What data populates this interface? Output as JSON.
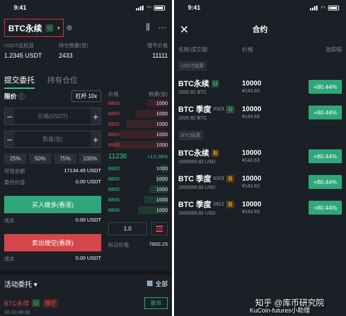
{
  "left": {
    "status_time": "9:41",
    "symbol": "BTC永续",
    "symbol_tag": "U",
    "stats": [
      {
        "label": "USDT总权益",
        "value": "1.2345 USDT",
        "color": "#ffffff"
      },
      {
        "label": "持仓数量(张)",
        "value": "2433",
        "color": "#2fc88a"
      },
      {
        "label": "强平价格",
        "value": "11111",
        "color": "#ffffff"
      }
    ],
    "tabs": [
      "提交委托",
      "持有仓位"
    ],
    "order_type": "限价",
    "leverage": "杠杆 10x",
    "price_placeholder": "价格(USDT)",
    "qty_placeholder": "数量(张)",
    "minus": "−",
    "plus": "+",
    "percents": [
      "25%",
      "50%",
      "75%",
      "100%"
    ],
    "available_label": "可用余额",
    "available_value": "17134.45 USDT",
    "order_value_label": "委托价值",
    "order_value": "0.00 USDT",
    "buy_label": "买入做多(看涨)",
    "cost_label": "成本",
    "cost_value": "0.00 USDT",
    "sell_label": "卖出做空(看跌)",
    "cost2_label": "成本",
    "cost2_value": "0.00 USDT",
    "book_price_header": "价格",
    "book_qty_header": "数量(张)",
    "asks": [
      {
        "price": "8800",
        "qty": "1000",
        "depth": 0.35
      },
      {
        "price": "8800",
        "qty": "1000",
        "depth": 0.55
      },
      {
        "price": "8800",
        "qty": "1000",
        "depth": 0.7
      },
      {
        "price": "8800",
        "qty": "1000",
        "depth": 0.8
      },
      {
        "price": "8800",
        "qty": "1000",
        "depth": 0.9
      }
    ],
    "last_price": "11236",
    "last_change": "+13.28%",
    "bids": [
      {
        "price": "8800",
        "qty": "1000",
        "depth": 0.1
      },
      {
        "price": "8800",
        "qty": "1000",
        "depth": 0.2
      },
      {
        "price": "8800",
        "qty": "1000",
        "depth": 0.3
      },
      {
        "price": "8800",
        "qty": "1000",
        "depth": 0.4
      },
      {
        "price": "8800",
        "qty": "1000",
        "depth": 0.5
      }
    ],
    "depth_select": "1.0",
    "mark_label": "标记价格",
    "mark_value": "7800.25",
    "active_orders": "活动委托 ▾",
    "all_label": "全部",
    "pos_symbol": "BTC永续",
    "pos_tag": "U",
    "pos_side": "做空",
    "cancel_label": "撤单",
    "pos_date": "16-10 08:30"
  },
  "right": {
    "status_time": "9:41",
    "title": "合约",
    "col_name": "名称/成交额",
    "col_price": "价格",
    "col_change": "涨跌幅",
    "sections": [
      {
        "label": "USDT结算",
        "rows": [
          {
            "name": "BTC永续",
            "code": "",
            "tag": "U",
            "volume": "1000.82 BTC",
            "price": "10000",
            "sub": "¥143.63",
            "change": "+80.44%"
          },
          {
            "name": "BTC 季度",
            "code": "0323",
            "tag": "U",
            "volume": "1000.82 BTC",
            "price": "10000",
            "sub": "¥143.63",
            "change": "+80.44%"
          }
        ]
      },
      {
        "label": "BTC结算",
        "rows": [
          {
            "name": "BTC永续",
            "code": "",
            "tag": "B",
            "volume": "1000000.82 USD",
            "price": "10000",
            "sub": "¥143.63",
            "change": "+80.44%"
          },
          {
            "name": "BTC 季度",
            "code": "0323",
            "tag": "B",
            "volume": "1000000.82 USD",
            "price": "10000",
            "sub": "¥143.63",
            "change": "+80.44%"
          },
          {
            "name": "BTC 季度",
            "code": "0912",
            "tag": "B",
            "volume": "1000000.82 USD",
            "price": "10000",
            "sub": "¥143.63",
            "change": "+80.44%"
          }
        ]
      }
    ]
  },
  "watermark": {
    "line1": "知乎 @库币研究院",
    "line2": "KuCoin-futures小助理"
  }
}
